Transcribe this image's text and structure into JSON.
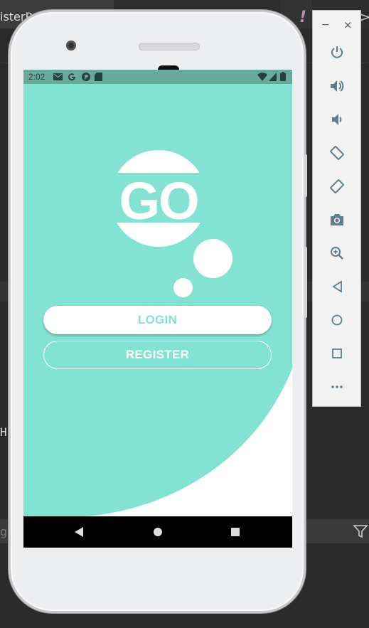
{
  "ide": {
    "tab_title": "isterP",
    "close_glyph": "×",
    "warning_glyph": "!",
    "overflow_glyph": ">",
    "code_fragment": "Hi",
    "bottom_text": "g"
  },
  "status_bar": {
    "time": "2:02"
  },
  "app": {
    "logo_text": "GO",
    "login_label": "LOGIN",
    "register_label": "REGISTER",
    "colors": {
      "accent": "#82e3d3",
      "status_bar": "#6aaa9d",
      "white": "#ffffff",
      "nav_bar": "#000000"
    }
  },
  "navigation": {
    "icons": [
      "back-icon",
      "home-icon",
      "recents-icon"
    ]
  },
  "emulator_toolbar": {
    "minimize_glyph": "−",
    "close_glyph": "×",
    "icons": [
      "power-icon",
      "volume-up-icon",
      "volume-down-icon",
      "rotate-left-icon",
      "rotate-right-icon",
      "camera-icon",
      "zoom-icon",
      "back-icon",
      "home-icon",
      "overview-icon",
      "more-icon"
    ]
  }
}
